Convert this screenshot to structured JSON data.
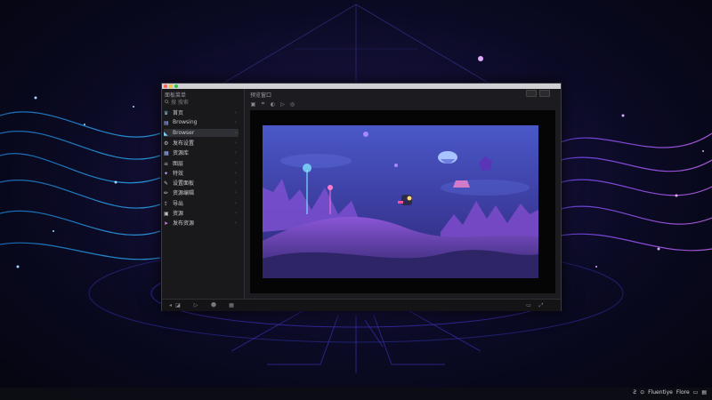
{
  "colors": {
    "accent": "#8a5cff",
    "window_bg": "#1e1e22",
    "sidebar_bg": "#19191c",
    "preview_bg": "#050506",
    "traffic_close": "#ff5f57",
    "traffic_min": "#febc2e",
    "traffic_max": "#28c840"
  },
  "window": {
    "sidebar_title": "面板菜单",
    "main_title": "预览窗口",
    "search_placeholder": "搜 搜索"
  },
  "sidebar": {
    "items": [
      {
        "label": "首页",
        "icon": "crown-icon"
      },
      {
        "label": "Browsing",
        "icon": "folder-icon"
      },
      {
        "label": "Browser",
        "icon": "bird-icon"
      },
      {
        "label": "发布设置",
        "icon": "gear-icon"
      },
      {
        "label": "资源库",
        "icon": "grid-icon"
      },
      {
        "label": "图层",
        "icon": "layers-icon"
      },
      {
        "label": "特效",
        "icon": "wand-icon"
      },
      {
        "label": "设置面板",
        "icon": "pen-icon"
      },
      {
        "label": "资源编辑",
        "icon": "pencil-icon"
      },
      {
        "label": "导出",
        "icon": "export-icon"
      },
      {
        "label": "资源",
        "icon": "image-icon"
      },
      {
        "label": "发布资源",
        "icon": "rocket-icon"
      }
    ]
  },
  "toolbar": {
    "icons": [
      "image-icon",
      "crop-icon",
      "adjust-icon",
      "play-icon",
      "target-icon"
    ]
  },
  "bottombar": {
    "icons": [
      "camera-icon",
      "play-icon",
      "people-icon",
      "grid-icon"
    ]
  },
  "tray": {
    "items": [
      "Ƨ",
      "⊙",
      "Fluentiye",
      "Flore",
      "▭",
      "▤"
    ]
  }
}
